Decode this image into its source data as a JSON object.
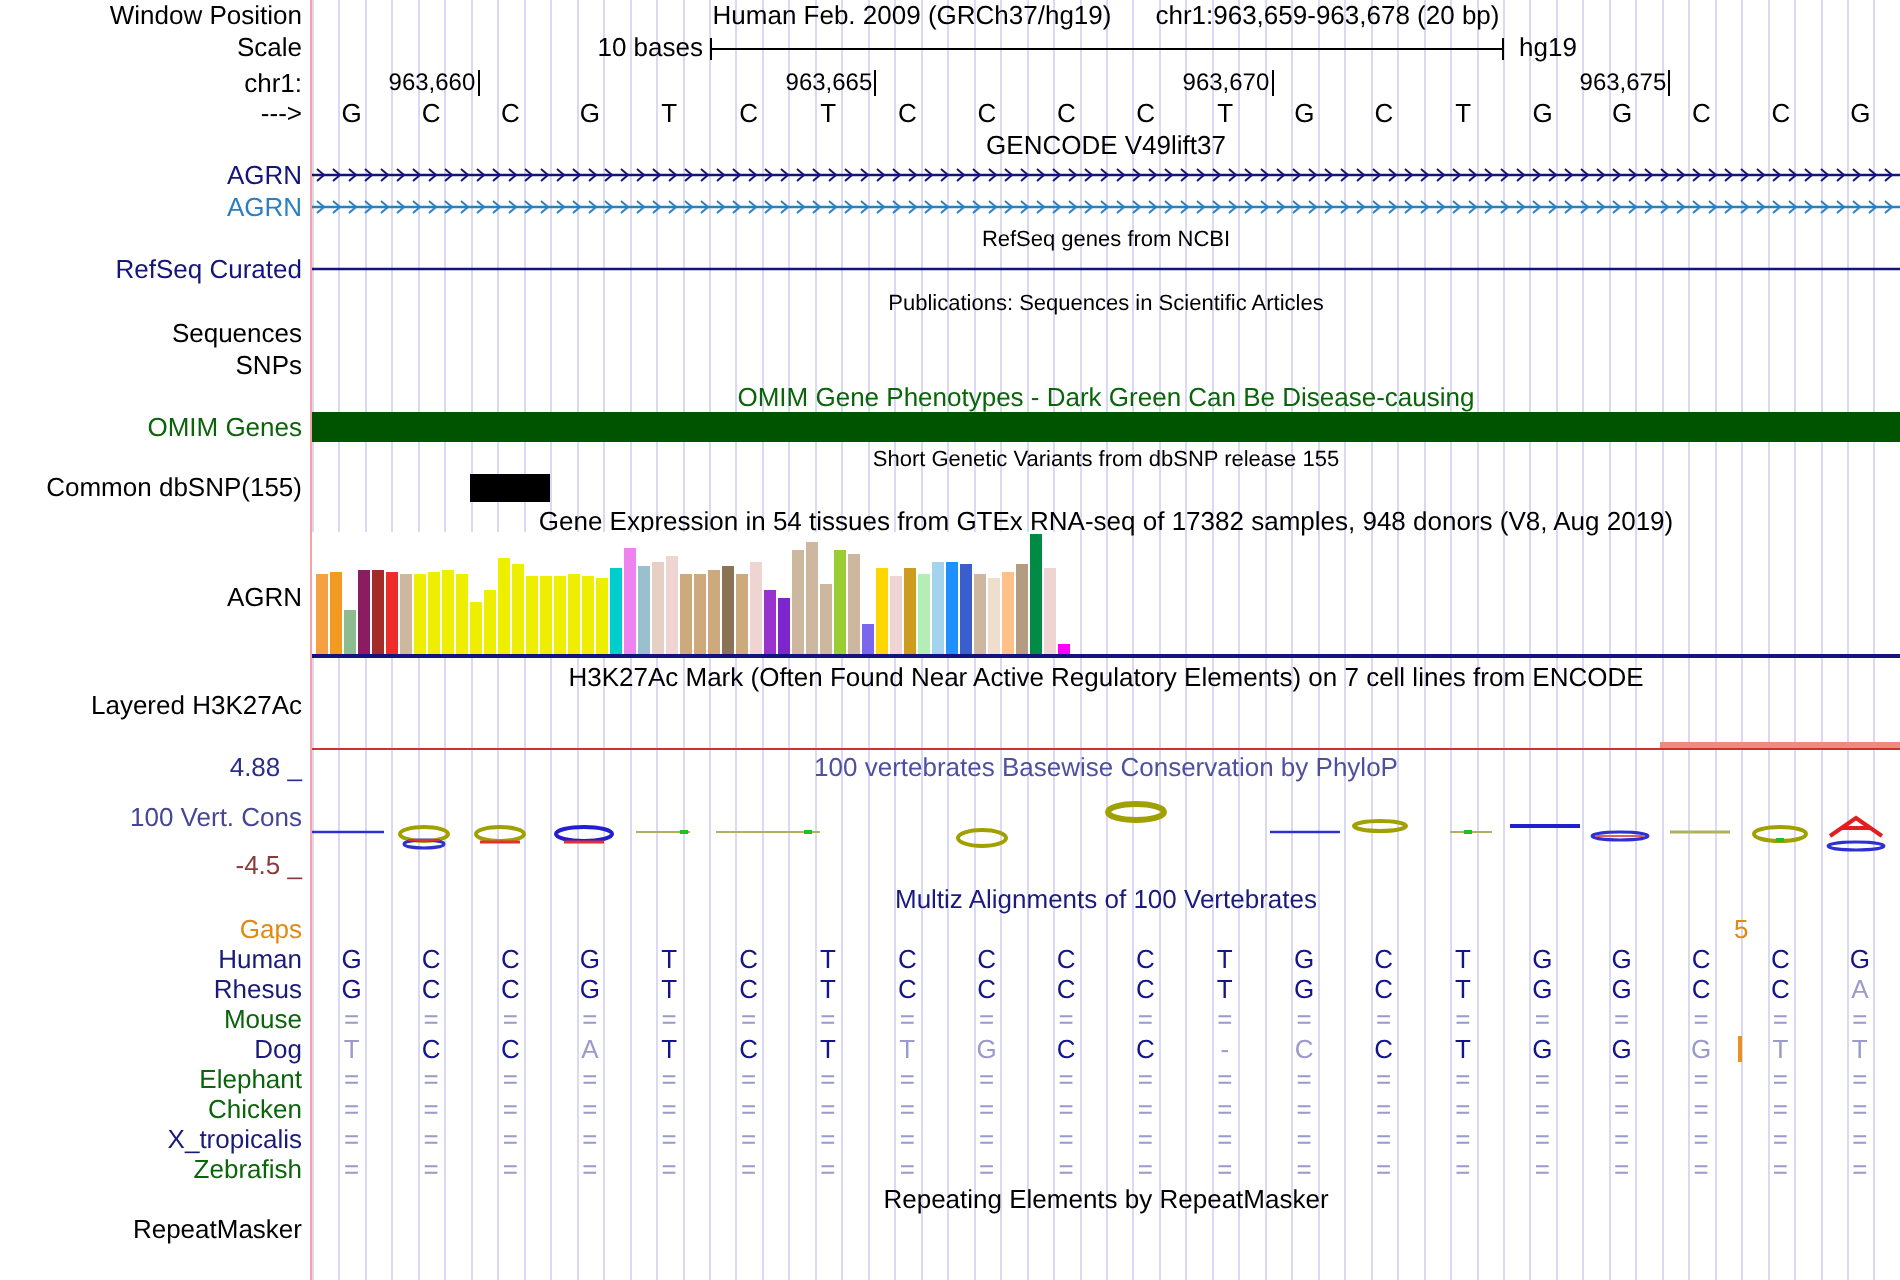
{
  "header": {
    "label": "Window Position",
    "assembly": "Human Feb. 2009 (GRCh37/hg19)",
    "position": "chr1:963,659-963,678 (20 bp)"
  },
  "scale": {
    "label": "Scale",
    "span": "10 bases",
    "assembly": "hg19"
  },
  "ruler": {
    "label": "chr1:",
    "ticks": [
      "963,660",
      "963,665",
      "963,670",
      "963,675"
    ]
  },
  "sequence": {
    "label": "--->",
    "bases": [
      "G",
      "C",
      "C",
      "G",
      "T",
      "C",
      "T",
      "C",
      "C",
      "C",
      "C",
      "T",
      "G",
      "C",
      "T",
      "G",
      "G",
      "C",
      "C",
      "G"
    ]
  },
  "tracks": [
    {
      "kind": "genes",
      "title": "GENCODE V49lift37",
      "items": [
        {
          "label": "AGRN",
          "color": "#14147a",
          "strand_arrows": true
        },
        {
          "label": "AGRN",
          "color": "#2a7fc0",
          "strand_arrows": true
        }
      ]
    },
    {
      "kind": "refseq",
      "title": "RefSeq genes from NCBI",
      "items": [
        {
          "label": "RefSeq Curated",
          "color": "#14147a",
          "strand_arrows": false
        }
      ]
    },
    {
      "kind": "publications",
      "title": "Publications: Sequences in Scientific Articles",
      "labels": [
        "Sequences",
        "SNPs"
      ]
    },
    {
      "kind": "omim",
      "title": "OMIM Gene Phenotypes - Dark Green Can Be Disease-causing",
      "label": "OMIM Genes"
    },
    {
      "kind": "snp",
      "title": "Short Genetic Variants from dbSNP release 155",
      "label": "Common dbSNP(155)"
    },
    {
      "kind": "expression",
      "title": "Gene Expression in 54 tissues from GTEx RNA-seq of 17382 samples, 948 donors (V8, Aug 2019)",
      "label": "AGRN"
    },
    {
      "kind": "layered",
      "title": "H3K27Ac Mark (Often Found Near Active Regulatory Elements) on 7 cell lines from ENCODE",
      "label": "Layered H3K27Ac"
    },
    {
      "kind": "conservation",
      "title": "100 vertebrates Basewise Conservation by PhyloP",
      "label": "100 Vert. Cons",
      "max": "4.88 _",
      "min": "-4.5 _"
    },
    {
      "kind": "multiz",
      "title": "Multiz Alignments of 100 Vertebrates",
      "gaps": {
        "label": "Gaps",
        "count": "5"
      },
      "species": [
        {
          "name": "Human",
          "color": "#1a1a7a",
          "bases": [
            {
              "kind": "base",
              "text": "G",
              "match": true
            },
            {
              "kind": "base",
              "text": "C",
              "match": true
            },
            {
              "kind": "base",
              "text": "C",
              "match": true
            },
            {
              "kind": "base",
              "text": "G",
              "match": true
            },
            {
              "kind": "base",
              "text": "T",
              "match": true
            },
            {
              "kind": "base",
              "text": "C",
              "match": true
            },
            {
              "kind": "base",
              "text": "T",
              "match": true
            },
            {
              "kind": "base",
              "text": "C",
              "match": true
            },
            {
              "kind": "base",
              "text": "C",
              "match": true
            },
            {
              "kind": "base",
              "text": "C",
              "match": true
            },
            {
              "kind": "base",
              "text": "C",
              "match": true
            },
            {
              "kind": "base",
              "text": "T",
              "match": true
            },
            {
              "kind": "base",
              "text": "G",
              "match": true
            },
            {
              "kind": "base",
              "text": "C",
              "match": true
            },
            {
              "kind": "base",
              "text": "T",
              "match": true
            },
            {
              "kind": "base",
              "text": "G",
              "match": true
            },
            {
              "kind": "base",
              "text": "G",
              "match": true
            },
            {
              "kind": "base",
              "text": "C",
              "match": true
            },
            {
              "kind": "base",
              "text": "C",
              "match": true
            },
            {
              "kind": "base",
              "text": "G",
              "match": true
            }
          ]
        },
        {
          "name": "Rhesus",
          "color": "#1a1a7a",
          "bases": [
            {
              "kind": "base",
              "text": "G",
              "match": true
            },
            {
              "kind": "base",
              "text": "C",
              "match": true
            },
            {
              "kind": "base",
              "text": "C",
              "match": true
            },
            {
              "kind": "base",
              "text": "G",
              "match": true
            },
            {
              "kind": "base",
              "text": "T",
              "match": true
            },
            {
              "kind": "base",
              "text": "C",
              "match": true
            },
            {
              "kind": "base",
              "text": "T",
              "match": true
            },
            {
              "kind": "base",
              "text": "C",
              "match": true
            },
            {
              "kind": "base",
              "text": "C",
              "match": true
            },
            {
              "kind": "base",
              "text": "C",
              "match": true
            },
            {
              "kind": "base",
              "text": "C",
              "match": true
            },
            {
              "kind": "base",
              "text": "T",
              "match": true
            },
            {
              "kind": "base",
              "text": "G",
              "match": true
            },
            {
              "kind": "base",
              "text": "C",
              "match": true
            },
            {
              "kind": "base",
              "text": "T",
              "match": true
            },
            {
              "kind": "base",
              "text": "G",
              "match": true
            },
            {
              "kind": "base",
              "text": "G",
              "match": true
            },
            {
              "kind": "base",
              "text": "C",
              "match": true
            },
            {
              "kind": "base",
              "text": "C",
              "match": true
            },
            {
              "kind": "base",
              "text": "A",
              "match": false
            }
          ]
        },
        {
          "name": "Mouse",
          "color": "#0a640a",
          "bases": [
            {
              "kind": "base",
              "text": "=",
              "match": false
            },
            {
              "kind": "base",
              "text": "=",
              "match": false
            },
            {
              "kind": "base",
              "text": "=",
              "match": false
            },
            {
              "kind": "base",
              "text": "=",
              "match": false
            },
            {
              "kind": "base",
              "text": "=",
              "match": false
            },
            {
              "kind": "base",
              "text": "=",
              "match": false
            },
            {
              "kind": "base",
              "text": "=",
              "match": false
            },
            {
              "kind": "base",
              "text": "=",
              "match": false
            },
            {
              "kind": "base",
              "text": "=",
              "match": false
            },
            {
              "kind": "base",
              "text": "=",
              "match": false
            },
            {
              "kind": "base",
              "text": "=",
              "match": false
            },
            {
              "kind": "base",
              "text": "=",
              "match": false
            },
            {
              "kind": "base",
              "text": "=",
              "match": false
            },
            {
              "kind": "base",
              "text": "=",
              "match": false
            },
            {
              "kind": "base",
              "text": "=",
              "match": false
            },
            {
              "kind": "base",
              "text": "=",
              "match": false
            },
            {
              "kind": "base",
              "text": "=",
              "match": false
            },
            {
              "kind": "base",
              "text": "=",
              "match": false
            },
            {
              "kind": "base",
              "text": "=",
              "match": false
            },
            {
              "kind": "base",
              "text": "=",
              "match": false
            }
          ]
        },
        {
          "name": "Dog",
          "color": "#1a1a7a",
          "bases": [
            {
              "kind": "base",
              "text": "T",
              "match": false
            },
            {
              "kind": "base",
              "text": "C",
              "match": true
            },
            {
              "kind": "base",
              "text": "C",
              "match": true
            },
            {
              "kind": "base",
              "text": "A",
              "match": false
            },
            {
              "kind": "base",
              "text": "T",
              "match": true
            },
            {
              "kind": "base",
              "text": "C",
              "match": true
            },
            {
              "kind": "base",
              "text": "T",
              "match": true
            },
            {
              "kind": "base",
              "text": "T",
              "match": false
            },
            {
              "kind": "base",
              "text": "G",
              "match": false
            },
            {
              "kind": "base",
              "text": "C",
              "match": true
            },
            {
              "kind": "base",
              "text": "C",
              "match": true
            },
            {
              "kind": "base",
              "text": "-",
              "match": false
            },
            {
              "kind": "base",
              "text": "C",
              "match": false
            },
            {
              "kind": "base",
              "text": "C",
              "match": true
            },
            {
              "kind": "base",
              "text": "T",
              "match": true
            },
            {
              "kind": "base",
              "text": "G",
              "match": true
            },
            {
              "kind": "base",
              "text": "G",
              "match": true
            },
            {
              "kind": "base",
              "text": "G",
              "match": false
            },
            {
              "kind": "insertion"
            },
            {
              "kind": "base",
              "text": "T",
              "match": false
            },
            {
              "kind": "base",
              "text": "T",
              "match": false
            }
          ]
        },
        {
          "name": "Elephant",
          "color": "#0a640a",
          "bases": [
            {
              "kind": "base",
              "text": "=",
              "match": false
            },
            {
              "kind": "base",
              "text": "=",
              "match": false
            },
            {
              "kind": "base",
              "text": "=",
              "match": false
            },
            {
              "kind": "base",
              "text": "=",
              "match": false
            },
            {
              "kind": "base",
              "text": "=",
              "match": false
            },
            {
              "kind": "base",
              "text": "=",
              "match": false
            },
            {
              "kind": "base",
              "text": "=",
              "match": false
            },
            {
              "kind": "base",
              "text": "=",
              "match": false
            },
            {
              "kind": "base",
              "text": "=",
              "match": false
            },
            {
              "kind": "base",
              "text": "=",
              "match": false
            },
            {
              "kind": "base",
              "text": "=",
              "match": false
            },
            {
              "kind": "base",
              "text": "=",
              "match": false
            },
            {
              "kind": "base",
              "text": "=",
              "match": false
            },
            {
              "kind": "base",
              "text": "=",
              "match": false
            },
            {
              "kind": "base",
              "text": "=",
              "match": false
            },
            {
              "kind": "base",
              "text": "=",
              "match": false
            },
            {
              "kind": "base",
              "text": "=",
              "match": false
            },
            {
              "kind": "base",
              "text": "=",
              "match": false
            },
            {
              "kind": "base",
              "text": "=",
              "match": false
            },
            {
              "kind": "base",
              "text": "=",
              "match": false
            }
          ]
        },
        {
          "name": "Chicken",
          "color": "#0a640a",
          "bases": [
            {
              "kind": "base",
              "text": "=",
              "match": false
            },
            {
              "kind": "base",
              "text": "=",
              "match": false
            },
            {
              "kind": "base",
              "text": "=",
              "match": false
            },
            {
              "kind": "base",
              "text": "=",
              "match": false
            },
            {
              "kind": "base",
              "text": "=",
              "match": false
            },
            {
              "kind": "base",
              "text": "=",
              "match": false
            },
            {
              "kind": "base",
              "text": "=",
              "match": false
            },
            {
              "kind": "base",
              "text": "=",
              "match": false
            },
            {
              "kind": "base",
              "text": "=",
              "match": false
            },
            {
              "kind": "base",
              "text": "=",
              "match": false
            },
            {
              "kind": "base",
              "text": "=",
              "match": false
            },
            {
              "kind": "base",
              "text": "=",
              "match": false
            },
            {
              "kind": "base",
              "text": "=",
              "match": false
            },
            {
              "kind": "base",
              "text": "=",
              "match": false
            },
            {
              "kind": "base",
              "text": "=",
              "match": false
            },
            {
              "kind": "base",
              "text": "=",
              "match": false
            },
            {
              "kind": "base",
              "text": "=",
              "match": false
            },
            {
              "kind": "base",
              "text": "=",
              "match": false
            },
            {
              "kind": "base",
              "text": "=",
              "match": false
            },
            {
              "kind": "base",
              "text": "=",
              "match": false
            }
          ]
        },
        {
          "name": "X_tropicalis",
          "color": "#1a1a7a",
          "bases": [
            {
              "kind": "base",
              "text": "=",
              "match": false
            },
            {
              "kind": "base",
              "text": "=",
              "match": false
            },
            {
              "kind": "base",
              "text": "=",
              "match": false
            },
            {
              "kind": "base",
              "text": "=",
              "match": false
            },
            {
              "kind": "base",
              "text": "=",
              "match": false
            },
            {
              "kind": "base",
              "text": "=",
              "match": false
            },
            {
              "kind": "base",
              "text": "=",
              "match": false
            },
            {
              "kind": "base",
              "text": "=",
              "match": false
            },
            {
              "kind": "base",
              "text": "=",
              "match": false
            },
            {
              "kind": "base",
              "text": "=",
              "match": false
            },
            {
              "kind": "base",
              "text": "=",
              "match": false
            },
            {
              "kind": "base",
              "text": "=",
              "match": false
            },
            {
              "kind": "base",
              "text": "=",
              "match": false
            },
            {
              "kind": "base",
              "text": "=",
              "match": false
            },
            {
              "kind": "base",
              "text": "=",
              "match": false
            },
            {
              "kind": "base",
              "text": "=",
              "match": false
            },
            {
              "kind": "base",
              "text": "=",
              "match": false
            },
            {
              "kind": "base",
              "text": "=",
              "match": false
            },
            {
              "kind": "base",
              "text": "=",
              "match": false
            },
            {
              "kind": "base",
              "text": "=",
              "match": false
            }
          ]
        },
        {
          "name": "Zebrafish",
          "color": "#0a640a",
          "bases": [
            {
              "kind": "base",
              "text": "=",
              "match": false
            },
            {
              "kind": "base",
              "text": "=",
              "match": false
            },
            {
              "kind": "base",
              "text": "=",
              "match": false
            },
            {
              "kind": "base",
              "text": "=",
              "match": false
            },
            {
              "kind": "base",
              "text": "=",
              "match": false
            },
            {
              "kind": "base",
              "text": "=",
              "match": false
            },
            {
              "kind": "base",
              "text": "=",
              "match": false
            },
            {
              "kind": "base",
              "text": "=",
              "match": false
            },
            {
              "kind": "base",
              "text": "=",
              "match": false
            },
            {
              "kind": "base",
              "text": "=",
              "match": false
            },
            {
              "kind": "base",
              "text": "=",
              "match": false
            },
            {
              "kind": "base",
              "text": "=",
              "match": false
            },
            {
              "kind": "base",
              "text": "=",
              "match": false
            },
            {
              "kind": "base",
              "text": "=",
              "match": false
            },
            {
              "kind": "base",
              "text": "=",
              "match": false
            },
            {
              "kind": "base",
              "text": "=",
              "match": false
            },
            {
              "kind": "base",
              "text": "=",
              "match": false
            },
            {
              "kind": "base",
              "text": "=",
              "match": false
            },
            {
              "kind": "base",
              "text": "=",
              "match": false
            },
            {
              "kind": "base",
              "text": "=",
              "match": false
            }
          ]
        }
      ]
    },
    {
      "kind": "repeats",
      "title": "Repeating Elements by RepeatMasker",
      "label": "RepeatMasker"
    }
  ]
}
